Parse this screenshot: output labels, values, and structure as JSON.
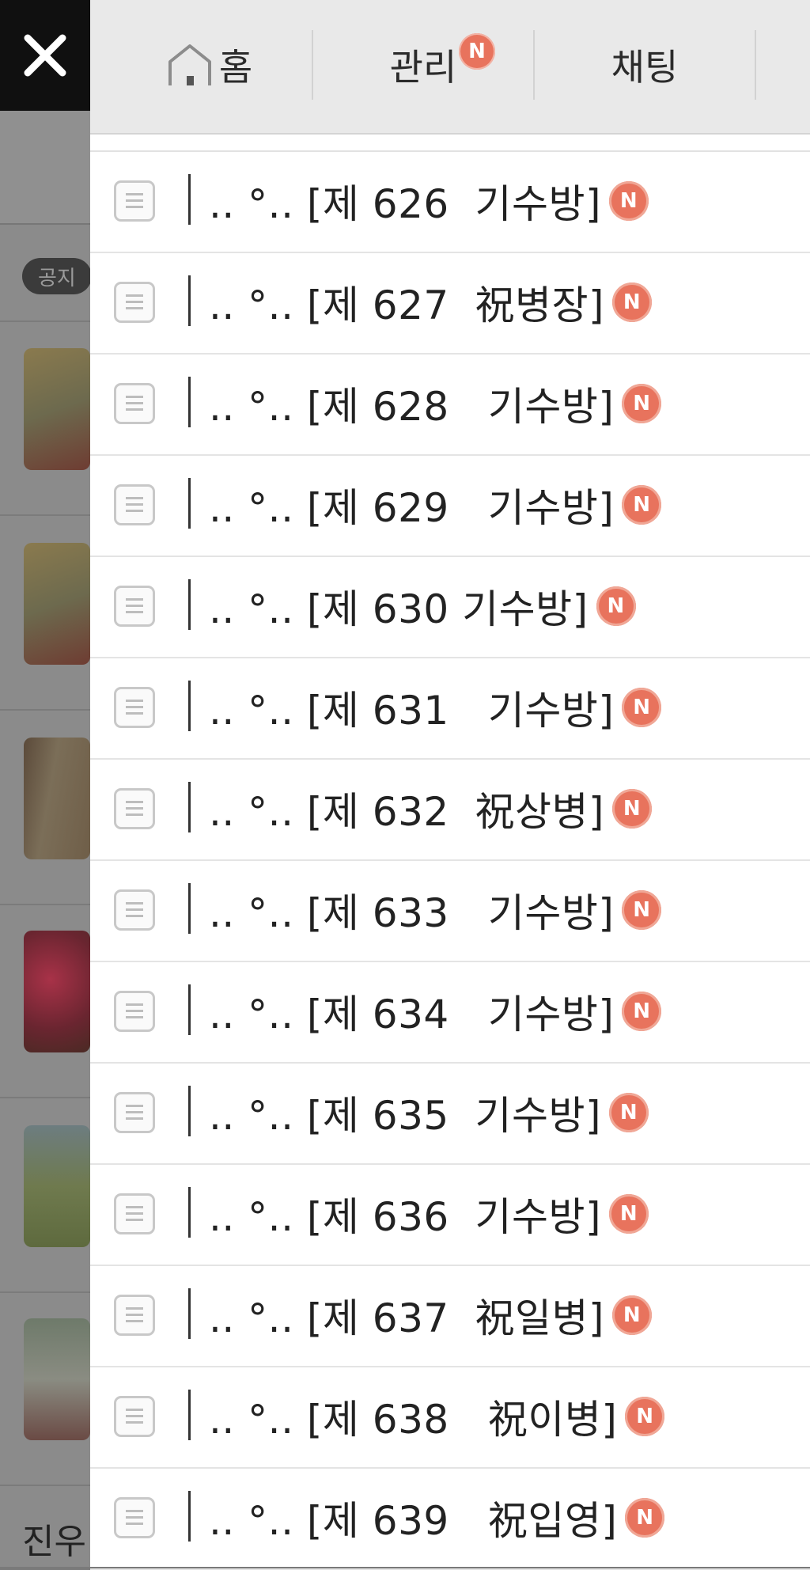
{
  "background": {
    "notice_label": "공지",
    "bottom_text": "진우"
  },
  "drawer": {
    "tabs": [
      {
        "label": "홈",
        "icon": "home-icon"
      },
      {
        "label": "관리",
        "badge": "N"
      },
      {
        "label": "채팅"
      }
    ],
    "posts": [
      {
        "title": ".. °.. [제 626  기수방]",
        "badge": "N"
      },
      {
        "title": ".. °.. [제 627  祝병장]",
        "badge": "N"
      },
      {
        "title": ".. °.. [제 628   기수방]",
        "badge": "N"
      },
      {
        "title": ".. °.. [제 629   기수방]",
        "badge": "N"
      },
      {
        "title": ".. °.. [제 630 기수방]",
        "badge": "N"
      },
      {
        "title": ".. °.. [제 631   기수방]",
        "badge": "N"
      },
      {
        "title": ".. °.. [제 632  祝상병]",
        "badge": "N"
      },
      {
        "title": ".. °.. [제 633   기수방]",
        "badge": "N"
      },
      {
        "title": ".. °.. [제 634   기수방]",
        "badge": "N"
      },
      {
        "title": ".. °.. [제 635  기수방]",
        "badge": "N"
      },
      {
        "title": ".. °.. [제 636  기수방]",
        "badge": "N"
      },
      {
        "title": ".. °.. [제 637  祝일병]",
        "badge": "N"
      },
      {
        "title": ".. °.. [제 638   祝이병]",
        "badge": "N"
      },
      {
        "title": ".. °.. [제 639   祝입영]",
        "badge": "N"
      }
    ]
  },
  "colors": {
    "badge": "#e8735d",
    "tab_bar": "#e9e9e9",
    "overlay": "#8b8b8b"
  }
}
